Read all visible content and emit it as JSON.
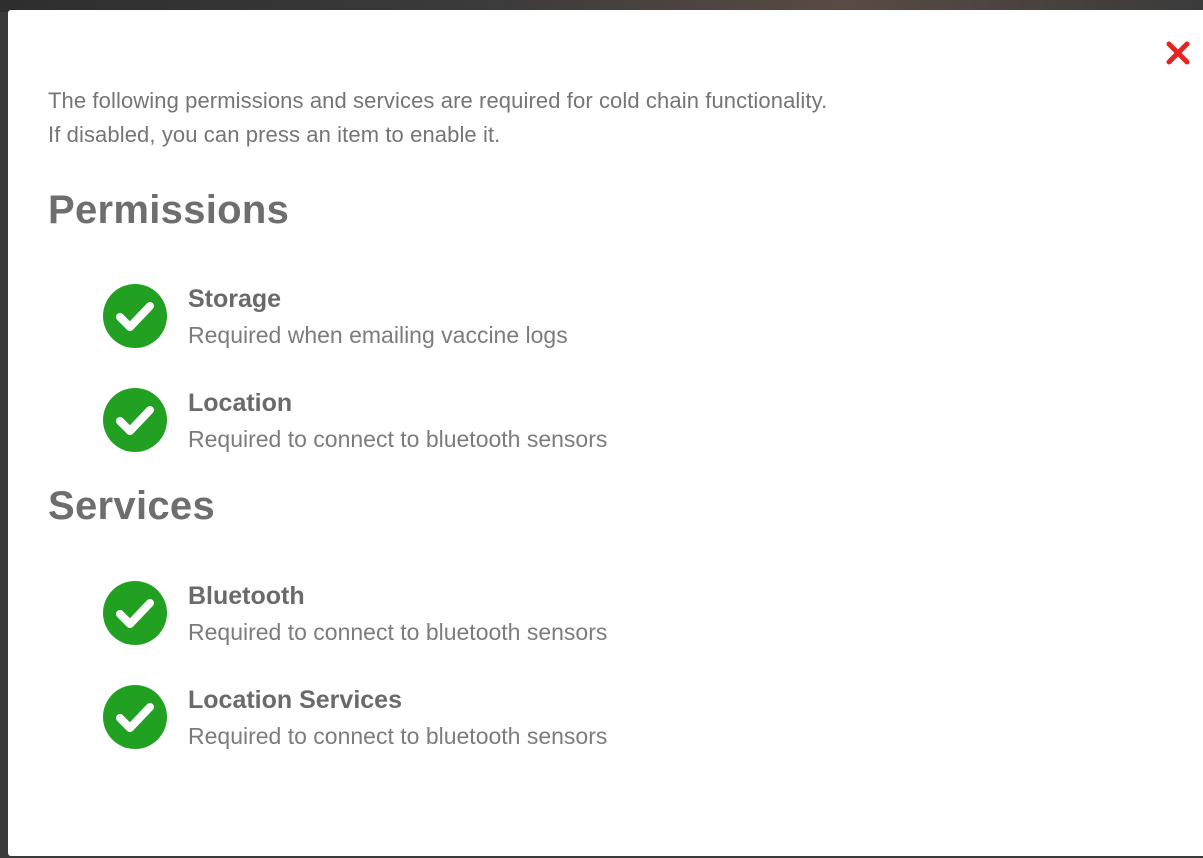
{
  "dialog": {
    "close_icon": "close-icon",
    "close_color": "#e8231f",
    "intro_line_1": "The following permissions and services are required for cold chain functionality.",
    "intro_line_2": "If disabled, you can press an item to enable it."
  },
  "permissions": {
    "title": "Permissions",
    "items": [
      {
        "label": "Storage",
        "description": "Required when emailing vaccine logs",
        "status_icon": "check-circle-icon",
        "enabled": true
      },
      {
        "label": "Location",
        "description": "Required to connect to bluetooth sensors",
        "status_icon": "check-circle-icon",
        "enabled": true
      }
    ]
  },
  "services": {
    "title": "Services",
    "items": [
      {
        "label": "Bluetooth",
        "description": "Required to connect to bluetooth sensors",
        "status_icon": "check-circle-icon",
        "enabled": true
      },
      {
        "label": "Location Services",
        "description": "Required to connect to bluetooth sensors",
        "status_icon": "check-circle-icon",
        "enabled": true
      }
    ]
  },
  "colors": {
    "check_green": "#22a021",
    "heading_gray": "#6e6e6e",
    "text_gray": "#757575"
  }
}
